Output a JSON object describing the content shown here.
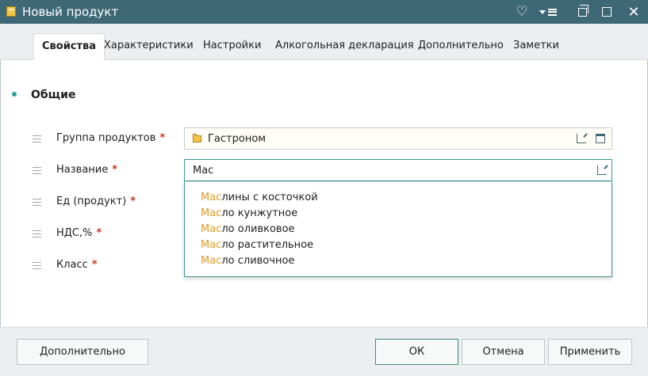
{
  "window": {
    "title": "Новый продукт"
  },
  "tabs": [
    {
      "label": "Свойства"
    },
    {
      "label": "Характеристики"
    },
    {
      "label": "Настройки"
    },
    {
      "label": "Алкогольная декларация"
    },
    {
      "label": "Дополнительно"
    },
    {
      "label": "Заметки"
    }
  ],
  "section": {
    "title": "Общие"
  },
  "fields": [
    {
      "label": "Группа продуктов",
      "required": "*",
      "value": "Гастроном"
    },
    {
      "label": "Название",
      "required": "*",
      "value": "Мас"
    },
    {
      "label": "Ед (продукт)",
      "required": "*"
    },
    {
      "label": "НДС,%",
      "required": "*"
    },
    {
      "label": "Класс",
      "required": "*"
    }
  ],
  "suggestions": [
    {
      "match": "Мас",
      "rest": "лины с косточкой"
    },
    {
      "match": "Мас",
      "rest": "ло кунжутное"
    },
    {
      "match": "Мас",
      "rest": "ло оливковое"
    },
    {
      "match": "Мас",
      "rest": "ло растительное"
    },
    {
      "match": "Мас",
      "rest": "ло сливочное"
    }
  ],
  "footer": {
    "more_label": "Дополнительно",
    "ok_label": "ОК",
    "cancel_label": "Отмена",
    "apply_label": "Применить"
  },
  "colors": {
    "titlebar": "#3f6877",
    "accent": "#3a9a93",
    "highlight": "#e39a2b",
    "required": "#c0392b"
  }
}
